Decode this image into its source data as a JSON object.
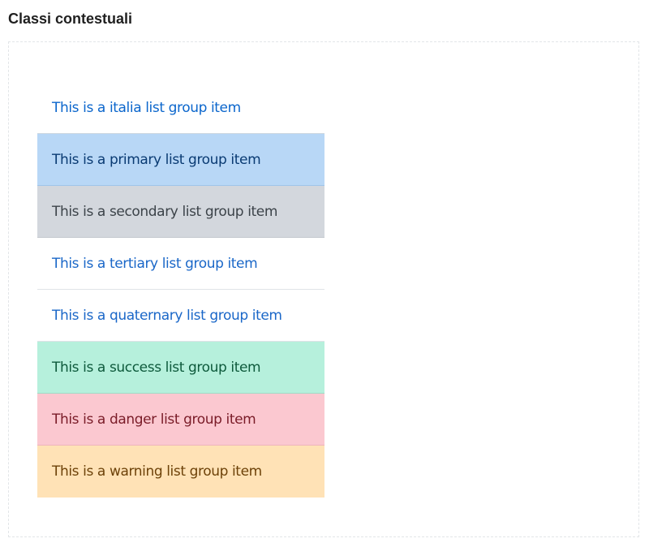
{
  "header": {
    "title": "Classi contestuali"
  },
  "list_group": {
    "items": [
      {
        "label": "This is a italia list group item",
        "variant": "italia"
      },
      {
        "label": "This is a primary list group item",
        "variant": "primary"
      },
      {
        "label": "This is a secondary list group item",
        "variant": "secondary"
      },
      {
        "label": "This is a tertiary list group item",
        "variant": "tertiary"
      },
      {
        "label": "This is a quaternary list group item",
        "variant": "quaternary"
      },
      {
        "label": "This is a success list group item",
        "variant": "success"
      },
      {
        "label": "This is a danger list group item",
        "variant": "danger"
      },
      {
        "label": "This is a warning list group item",
        "variant": "warning"
      }
    ]
  },
  "colors": {
    "italia_text": "#0b66cc",
    "primary_bg": "#b8d7f6",
    "secondary_bg": "#d3d7dd",
    "success_bg": "#b6f0dc",
    "danger_bg": "#fbc8d0",
    "warning_bg": "#ffe2b6"
  }
}
